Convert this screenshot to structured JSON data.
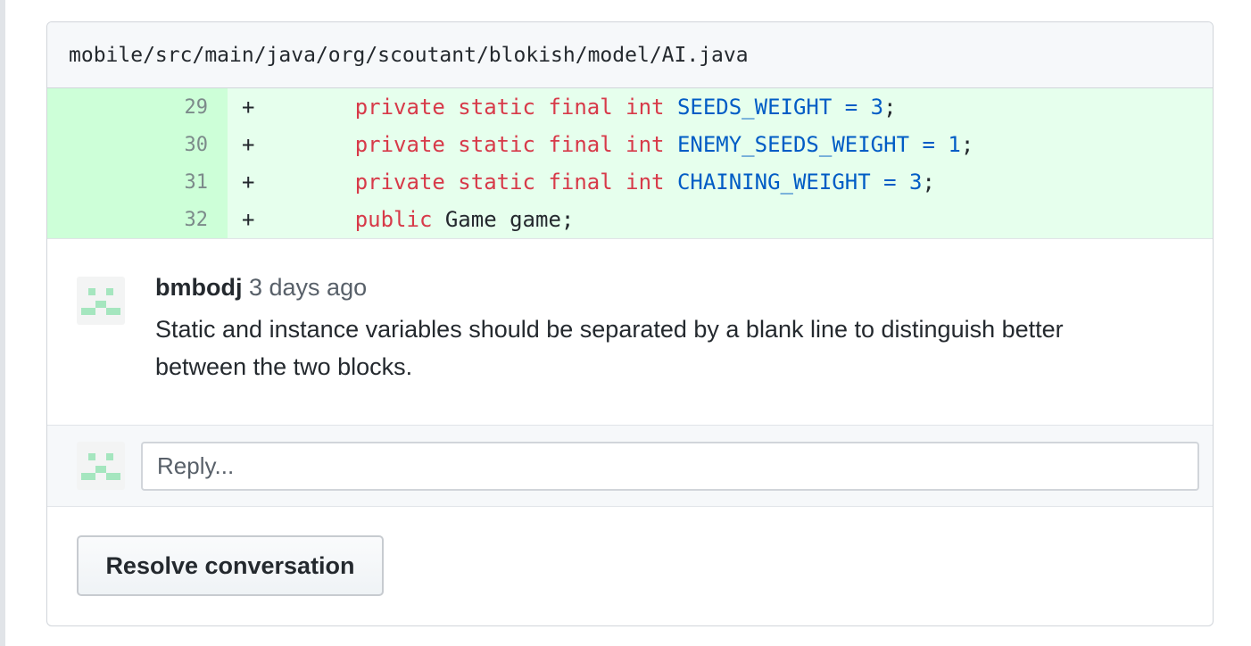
{
  "file": {
    "path": "mobile/src/main/java/org/scoutant/blokish/model/AI.java"
  },
  "diff": {
    "lines": [
      {
        "number": "29",
        "marker": "+",
        "indent": "      ",
        "tokens": [
          {
            "text": "private static final int ",
            "kind": "kw"
          },
          {
            "text": "SEEDS_WEIGHT = 3",
            "kind": "const"
          },
          {
            "text": ";",
            "kind": "plain"
          }
        ]
      },
      {
        "number": "30",
        "marker": "+",
        "indent": "      ",
        "tokens": [
          {
            "text": "private static final int ",
            "kind": "kw"
          },
          {
            "text": "ENEMY_SEEDS_WEIGHT = 1",
            "kind": "const"
          },
          {
            "text": ";",
            "kind": "plain"
          }
        ]
      },
      {
        "number": "31",
        "marker": "+",
        "indent": "      ",
        "tokens": [
          {
            "text": "private static final int ",
            "kind": "kw"
          },
          {
            "text": "CHAINING_WEIGHT = 3",
            "kind": "const"
          },
          {
            "text": ";",
            "kind": "plain"
          }
        ]
      },
      {
        "number": "32",
        "marker": "+",
        "indent": "      ",
        "tokens": [
          {
            "text": "public ",
            "kind": "kw"
          },
          {
            "text": "Game game;",
            "kind": "plain"
          }
        ]
      }
    ]
  },
  "comment": {
    "author": "bmbodj",
    "timestamp": "3 days ago",
    "body": "Static and instance variables should be separated by a blank line to distinguish better between the two blocks.",
    "avatar_icon": "identicon-avatar"
  },
  "reply": {
    "placeholder": "Reply...",
    "value": "",
    "avatar_icon": "identicon-avatar"
  },
  "actions": {
    "resolve_label": "Resolve conversation"
  },
  "colors": {
    "added_line_bg": "#e6ffed",
    "added_num_bg": "#cdffd8",
    "keyword": "#d73a49",
    "constant": "#005cc5",
    "identicon": "#a5e6bf"
  }
}
